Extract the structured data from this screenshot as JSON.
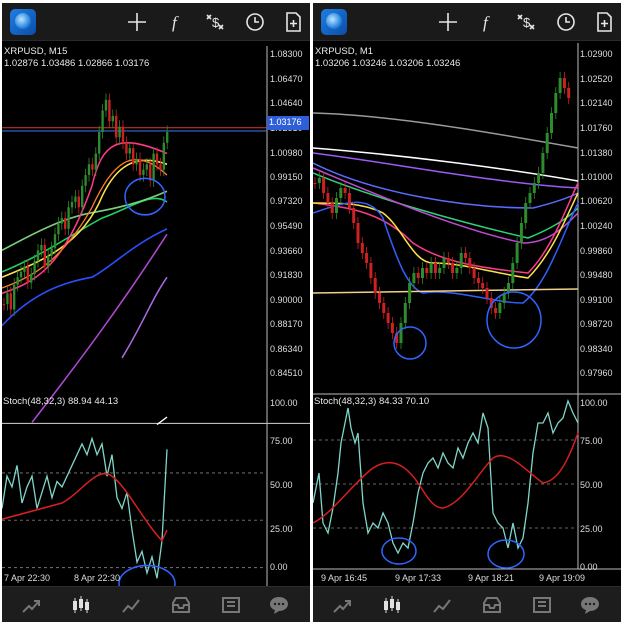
{
  "panels": [
    {
      "symbol_title": "XRPUSD, M15",
      "ohlc": "1.02876 1.03486 1.02866 1.03176",
      "price_labels": [
        "1.08300",
        "1.06470",
        "1.04640",
        "1.02810",
        "1.00980",
        "0.99150",
        "0.97320",
        "0.95490",
        "0.93660",
        "0.91830",
        "0.90000",
        "0.88170",
        "0.86340",
        "0.84510"
      ],
      "current_price": "1.03176",
      "stoch_label": "Stoch(48,32,3) 88.94 44.13",
      "stoch_levels": [
        "100.00",
        "75.00",
        "50.00",
        "25.00",
        "0.00"
      ],
      "time_labels": [
        "7 Apr 22:30",
        "8 Apr 22:30"
      ]
    },
    {
      "symbol_title": "XRPUSD, M1",
      "ohlc": "1.03206 1.03246 1.03206 1.03246",
      "price_labels": [
        "1.02900",
        "1.02520",
        "1.02140",
        "1.01760",
        "1.01380",
        "1.01000",
        "1.00620",
        "1.00240",
        "0.99860",
        "0.99480",
        "0.99100",
        "0.98720",
        "0.98340",
        "0.97960"
      ],
      "current_price": "",
      "stoch_label": "Stoch(48,32,3) 84.33 70.10",
      "stoch_levels": [
        "100.00",
        "75.00",
        "50.00",
        "25.00",
        "0.00"
      ],
      "time_labels": [
        "9 Apr 16:45",
        "9 Apr 17:33",
        "9 Apr 18:21",
        "9 Apr 19:09"
      ]
    }
  ],
  "toolbar_icons": [
    "app-logo-icon",
    "crosshair-icon",
    "indicators-icon",
    "symbols-icon",
    "history-clock-icon",
    "new-order-icon"
  ],
  "nav_icons": [
    "quotes-icon",
    "chart-icon",
    "trade-icon",
    "history-icon",
    "news-icon",
    "chat-icon"
  ],
  "colors": {
    "background": "#000000",
    "candle_up": "#2e8b2e",
    "candle_down": "#cc2222",
    "stoch_main": "#7fd6c8",
    "stoch_signal": "#d62020",
    "annotation": "#2f66ff",
    "price_tag": "#2f5fd8"
  }
}
